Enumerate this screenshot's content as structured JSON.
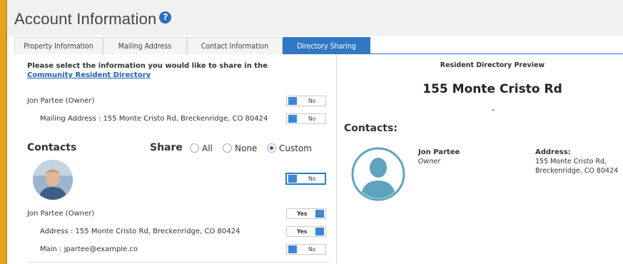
{
  "header": {
    "title": "Account Information",
    "help_icon": "question-circle-icon"
  },
  "tabs": [
    {
      "label": "Property Information",
      "active": false
    },
    {
      "label": "Mailing Address",
      "active": false
    },
    {
      "label": "Contact Information",
      "active": false
    },
    {
      "label": "Directory Sharing",
      "active": true
    }
  ],
  "sharing": {
    "intro_text": "Please select the information you would like to share in the ",
    "intro_link": "Community Resident Directory",
    "owner_row": {
      "label": "Jon Partee (Owner)",
      "toggle": "No"
    },
    "mailing_row": {
      "label": "Mailing Address : 155 Monte Cristo Rd, Breckenridge, CO 80424",
      "toggle": "No"
    },
    "contacts_heading": "Contacts",
    "share_label": "Share",
    "share_options": [
      "All",
      "None",
      "Custom"
    ],
    "share_selected": "Custom",
    "contact_photo_toggle": "No",
    "contact_rows": [
      {
        "label": "Jon Partee (Owner)",
        "toggle": "Yes"
      },
      {
        "label": "Address : 155 Monte Cristo Rd, Breckenridge, CO 80424",
        "toggle": "Yes"
      },
      {
        "label": "Main : jpartee@example.co",
        "toggle": "No"
      }
    ]
  },
  "preview": {
    "title": "Resident Directory Preview",
    "address": "155 Monte Cristo Rd",
    "contacts_heading": "Contacts:",
    "contact_name": "Jon Partee",
    "contact_role": "Owner",
    "address_label": "Address:",
    "address_line1": "155 Monte Cristo Rd,",
    "address_line2": "Breckenridge, CO 80424"
  },
  "colors": {
    "accent": "#2f78c4",
    "frame": "#e2a51c",
    "avatar_placeholder": "#5fa3be"
  }
}
